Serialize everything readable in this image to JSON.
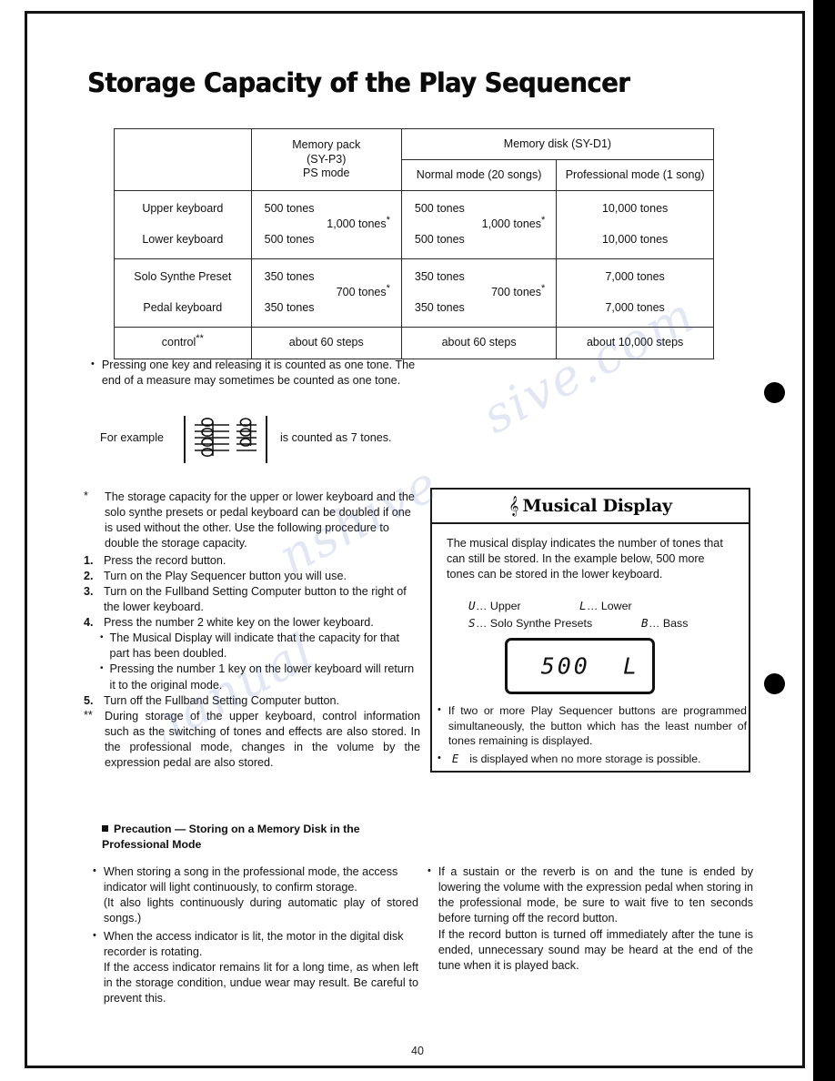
{
  "page": {
    "title": "Storage Capacity of the Play Sequencer",
    "folio": "40"
  },
  "table": {
    "headers": {
      "corner": "",
      "memory_pack": "Memory pack\n(SY-P3)\nPS mode",
      "memory_pack_l1": "Memory pack",
      "memory_pack_l2": "(SY-P3)",
      "memory_pack_l3": "PS mode",
      "memory_disk": "Memory disk (SY-D1)",
      "normal_mode": "Normal mode (20 songs)",
      "professional_mode": "Professional mode (1 song)"
    },
    "rows": [
      {
        "label_top": "Upper keyboard",
        "label_bottom": "Lower keyboard",
        "pack_top": "500 tones",
        "pack_bottom": "500 tones",
        "pack_sum": "1,000 tones",
        "pack_sum_mark": "*",
        "normal_top": "500 tones",
        "normal_bottom": "500 tones",
        "normal_sum": "1,000 tones",
        "normal_sum_mark": "*",
        "prof_top": "10,000 tones",
        "prof_bottom": "10,000 tones"
      },
      {
        "label_top": "Solo Synthe Preset",
        "label_bottom": "Pedal keyboard",
        "pack_top": "350 tones",
        "pack_bottom": "350 tones",
        "pack_sum": "700 tones",
        "pack_sum_mark": "*",
        "normal_top": "350 tones",
        "normal_bottom": "350 tones",
        "normal_sum": "700 tones",
        "normal_sum_mark": "*",
        "prof_top": "7,000 tones",
        "prof_bottom": "7,000 tones"
      }
    ],
    "control_row": {
      "label": "control",
      "label_mark": "**",
      "pack": "about 60 steps",
      "normal": "about 60 steps",
      "prof": "about 10,000 steps"
    }
  },
  "note_press": {
    "bullet": "•",
    "text": "Pressing one key and releasing it is counted as one tone. The end of a measure may sometimes be counted as one tone."
  },
  "example": {
    "label": "For example",
    "tail": "is counted as 7 tones."
  },
  "footnote_single": {
    "mark": "*",
    "text": "The storage capacity for the upper or lower keyboard and the solo synthe presets or pedal keyboard can be doubled if one is used without the other. Use the following procedure to double the storage capacity."
  },
  "steps": [
    {
      "num": "1.",
      "text": "Press the record button.",
      "subs": []
    },
    {
      "num": "2.",
      "text": "Turn on the Play Sequencer button you will use.",
      "subs": []
    },
    {
      "num": "3.",
      "text": "Turn on the Fullband Setting Computer button to the right of the lower keyboard.",
      "subs": []
    },
    {
      "num": "4.",
      "text": "Press the number 2 white key on the lower keyboard.",
      "subs": [
        "The Musical Display will indicate that the capacity for that part has been doubled.",
        "Pressing the number 1 key on the lower keyboard will return it to the original mode."
      ]
    },
    {
      "num": "5.",
      "text": "Turn off the Fullband Setting Computer button.",
      "subs": []
    }
  ],
  "footnote_double": {
    "mark": "**",
    "text": "During storage of the upper keyboard, control information such as the switching of tones and effects are also stored. In the professional mode, changes in the volume by the expression pedal are also stored."
  },
  "musical_display": {
    "title": "Musical Display",
    "clef_icon": "𝄞",
    "intro": "The musical display indicates the number of tones that can still be stored. In the example below, 500 more tones can be stored in the lower keyboard.",
    "legend": [
      {
        "code": "U",
        "dots": "…",
        "name": "Upper"
      },
      {
        "code": "L",
        "dots": "…",
        "name": "Lower"
      },
      {
        "code": "S",
        "dots": "…",
        "name": "Solo Synthe Presets"
      },
      {
        "code": "B",
        "dots": "…",
        "name": "Bass"
      }
    ],
    "lcd_reading": "500  L",
    "notes": [
      {
        "bullet": "•",
        "lcd": "",
        "text": "If two or more Play Sequencer buttons are programmed simultaneously, the button which has the least number of tones remaining is displayed."
      },
      {
        "bullet": "•",
        "lcd": "E",
        "text": "is displayed when no more storage is possible."
      }
    ]
  },
  "precaution": {
    "heading": "Precaution — Storing on a Memory Disk in the Professional Mode",
    "left_items": [
      "When storing a song in the professional mode, the access indicator will light continuously, to confirm storage.",
      "(It also lights continuously during automatic play of stored songs.)",
      "When the access indicator is lit, the motor in the digital disk recorder is rotating.",
      "If the access indicator remains lit for a long time, as when left in the storage condition, undue wear may result. Be careful to prevent this."
    ],
    "right_items": [
      "If a sustain or the reverb is on and the tune is ended by lowering the volume with the expression pedal when storing in the professional mode, be sure to wait five to ten seconds before turning off the record button.",
      "If the record button is turned off immediately after the tune is ended, unnecessary sound may be heard at the end of the tune when it is played back."
    ]
  },
  "watermark": {
    "line1": "sive.com",
    "line2": "nshive",
    "line3": "manual"
  }
}
